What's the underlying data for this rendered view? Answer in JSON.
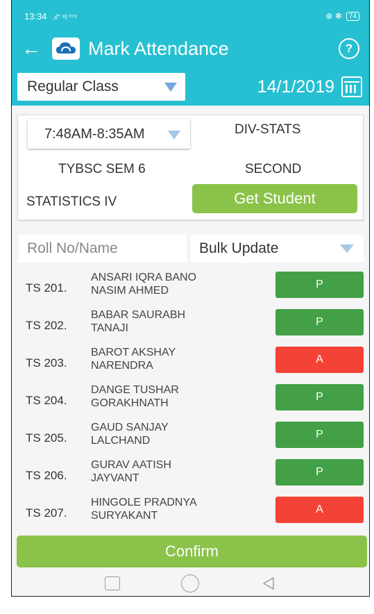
{
  "status_bar": {
    "time": "13:34",
    "signal": ".ıl\" ᵌᶥl ⁰⁷⁸",
    "icons": "⊕ ✻",
    "battery": "74"
  },
  "toolbar": {
    "title": "Mark Attendance",
    "help_glyph": "?"
  },
  "controls": {
    "class_type": "Regular Class",
    "date": "14/1/2019"
  },
  "card": {
    "time_slot": "7:48AM-8:35AM",
    "division": "DIV-STATS",
    "class_name": "TYBSC SEM 6",
    "slot_name": "SECOND",
    "subject": "STATISTICS IV",
    "get_student_label": "Get Student"
  },
  "filter": {
    "search_placeholder": "Roll No/Name",
    "bulk_label": "Bulk Update"
  },
  "students": [
    {
      "roll": "TS 201.",
      "name1": "ANSARI IQRA BANO",
      "name2": "NASIM AHMED",
      "status": "P"
    },
    {
      "roll": "TS 202.",
      "name1": "BABAR SAURABH",
      "name2": "TANAJI",
      "status": "P"
    },
    {
      "roll": "TS 203.",
      "name1": "BAROT AKSHAY",
      "name2": "NARENDRA",
      "status": "A"
    },
    {
      "roll": "TS 204.",
      "name1": "DANGE TUSHAR",
      "name2": "GORAKHNATH",
      "status": "P"
    },
    {
      "roll": "TS 205.",
      "name1": "GAUD SANJAY",
      "name2": "LALCHAND",
      "status": "P"
    },
    {
      "roll": "TS 206.",
      "name1": "GURAV AATISH",
      "name2": "JAYVANT",
      "status": "P"
    },
    {
      "roll": "TS 207.",
      "name1": "HINGOLE PRADNYA",
      "name2": "SURYAKANT",
      "status": "A"
    }
  ],
  "confirm_label": "Confirm",
  "colors": {
    "header": "#26c0d2",
    "present": "#43a047",
    "absent": "#f44336",
    "accent_button": "#8bc34a"
  }
}
